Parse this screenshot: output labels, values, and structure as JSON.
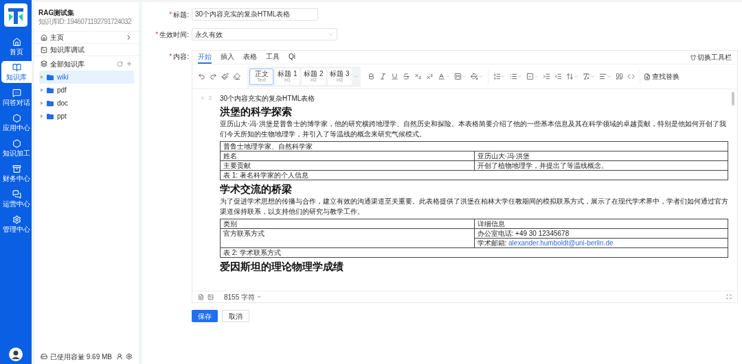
{
  "rail": {
    "items": [
      {
        "label": "首页",
        "selected": false
      },
      {
        "label": "知识库",
        "selected": true
      },
      {
        "label": "问答对话",
        "selected": false
      },
      {
        "label": "应用中心",
        "selected": false
      },
      {
        "label": "知识加工",
        "selected": false
      },
      {
        "label": "财务中心",
        "selected": false
      },
      {
        "label": "运营中心",
        "selected": false
      },
      {
        "label": "管理中心",
        "selected": false
      }
    ]
  },
  "knowledge_base": {
    "name": "RAG测试集",
    "id_text": "知识库ID: 1946071192791724032"
  },
  "nav": [
    {
      "label": "主页"
    },
    {
      "label": "知识库调试"
    }
  ],
  "tree": {
    "title": "全部知识库",
    "items": [
      {
        "label": "wiki",
        "selected": true
      },
      {
        "label": "pdf",
        "selected": false
      },
      {
        "label": "doc",
        "selected": false
      },
      {
        "label": "ppt",
        "selected": false
      }
    ]
  },
  "storage": "已使用容量 9.69 MB",
  "form": {
    "fields": [
      {
        "mark": "*",
        "label": "标题:",
        "kind": "input",
        "value": "30个内容充实的复杂HTML表格"
      },
      {
        "mark": "*",
        "label": "生效时间:",
        "kind": "select",
        "value": "永久有效"
      }
    ],
    "content_label": {
      "mark": "*",
      "label": "内容:"
    }
  },
  "editor": {
    "tabs": [
      {
        "label": "开始",
        "selected": true
      },
      {
        "label": "插入",
        "selected": false
      },
      {
        "label": "表格",
        "selected": false
      },
      {
        "label": "工具",
        "selected": false
      },
      {
        "label": "Qi",
        "selected": false
      }
    ],
    "toolbar_toggle": "切换工具栏",
    "styles": [
      {
        "label": "正文",
        "sublabel": "Text",
        "selected": true
      },
      {
        "label": "标题 1",
        "sublabel": "H1",
        "selected": false
      },
      {
        "label": "标题 2",
        "sublabel": "H2",
        "selected": false
      },
      {
        "label": "标题 3",
        "sublabel": "H3",
        "selected": false
      }
    ],
    "find_replace": "查找替换",
    "document": [
      {
        "kind": "paragraph",
        "text": "30个内容充实的复杂HTML表格"
      },
      {
        "kind": "heading",
        "text": "洪堡的科学探索"
      },
      {
        "kind": "paragraph",
        "text": "亚历山大·冯·洪堡是普鲁士的博学家，他的研究横跨地理学、自然历史和探险。本表格简要介绍了他的一些基本信息及其在科学领域的卓越贡献，特别是他如何开创了我们今天所知的生物地理学，并引入了等温线的概念来研究气候模式。"
      },
      {
        "kind": "table",
        "rows": [
          [
            {
              "text": "普鲁士地理学家、自然科学家",
              "colspan": 2
            }
          ],
          [
            {
              "text": "姓名"
            },
            {
              "text": "亚历山大·冯·洪堡"
            }
          ],
          [
            {
              "text": "主要贡献"
            },
            {
              "text": "开创了植物地理学，并提出了等温线概念。"
            }
          ],
          [
            {
              "text": "表 1: 著名科学家的个人信息",
              "colspan": 2
            }
          ]
        ]
      },
      {
        "kind": "heading",
        "text": "学术交流的桥梁"
      },
      {
        "kind": "paragraph",
        "text": "为了促进学术思想的传播与合作，建立有效的沟通渠道至关重要。此表格提供了洪堡在柏林大学任教期间的模拟联系方式，展示了在现代学术界中，学者们如何通过官方渠道保持联系，以支持他们的研究与教学工作。"
      },
      {
        "kind": "table",
        "rows": [
          [
            {
              "text": "类别"
            },
            {
              "text": "详细信息"
            }
          ],
          [
            {
              "text": "官方联系方式",
              "rowspan": 2
            },
            {
              "text": "办公室电话: +49 30 12345678"
            }
          ],
          [
            {
              "text": "学术邮箱: ",
              "link": "alexander.humboldt@uni-berlin.de"
            }
          ],
          [
            {
              "text": "表 2: 学术联系方式",
              "colspan": 2
            }
          ]
        ]
      },
      {
        "kind": "heading",
        "text": "爱因斯坦的理论物理学成绩"
      }
    ],
    "word_count": "8155 字符"
  },
  "buttons": [
    {
      "label": "保存",
      "kind": "primary"
    },
    {
      "label": "取消",
      "kind": "default"
    }
  ]
}
